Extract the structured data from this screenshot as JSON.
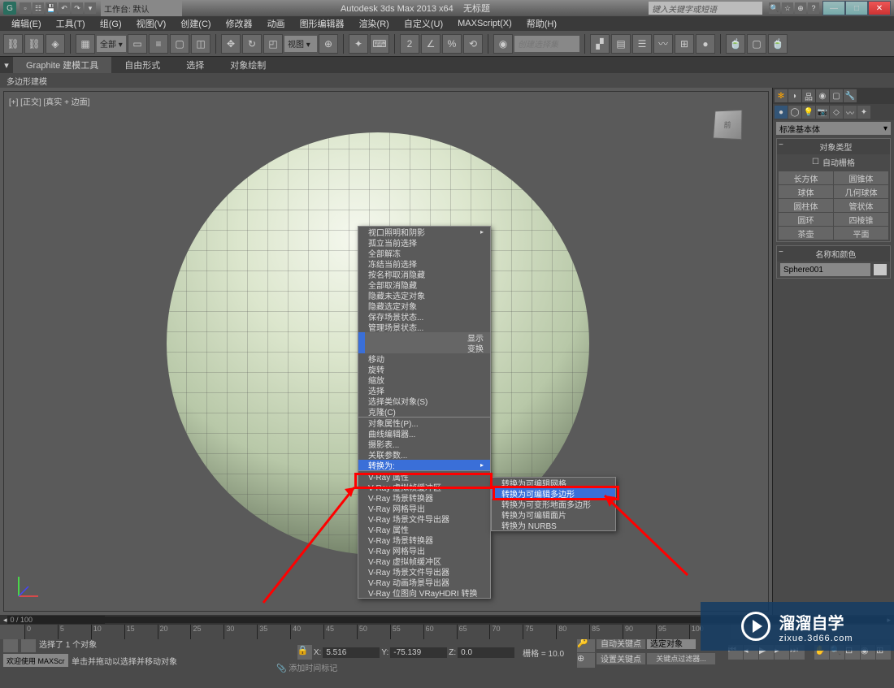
{
  "title_bar": {
    "app_title": "Autodesk 3ds Max  2013 x64",
    "doc_title": "无标题",
    "workspace_label": "工作台: 默认",
    "search_placeholder": "键入关键字或短语"
  },
  "menu_bar": {
    "items": [
      "编辑(E)",
      "工具(T)",
      "组(G)",
      "视图(V)",
      "创建(C)",
      "修改器",
      "动画",
      "图形编辑器",
      "渲染(R)",
      "自定义(U)",
      "MAXScript(X)",
      "帮助(H)"
    ]
  },
  "toolbar": {
    "selection_set": "创建选择集"
  },
  "ribbon": {
    "tabs": [
      "Graphite 建模工具",
      "自由形式",
      "选择",
      "对象绘制"
    ],
    "subtab": "多边形建模"
  },
  "viewport": {
    "label": "[+] [正交] [真实 + 边面]",
    "cube_face": "前"
  },
  "context_menu": {
    "items": [
      "视口照明和阴影",
      "孤立当前选择",
      "全部解冻",
      "冻结当前选择",
      "按名称取消隐藏",
      "全部取消隐藏",
      "隐藏未选定对象",
      "隐藏选定对象",
      "保存场景状态...",
      "管理场景状态..."
    ],
    "headers": [
      "显示",
      "变换"
    ],
    "items2": [
      "移动",
      "旋转",
      "缩放",
      "选择",
      "选择类似对象(S)",
      "克隆(C)",
      "对象属性(P)...",
      "曲线编辑器...",
      "摄影表...",
      "关联参数..."
    ],
    "convert_label": "转换为:",
    "items3": [
      "V-Ray 属性",
      "V-Ray 虚拟帧缓冲区",
      "V-Ray 场景转换器",
      "V-Ray 网格导出",
      "V-Ray 场景文件导出器",
      "V-Ray 属性",
      "V-Ray 场景转换器",
      "V-Ray 网格导出",
      "V-Ray 虚拟帧缓冲区",
      "V-Ray 场景文件导出器",
      "V-Ray 动画场景导出器",
      "V-Ray 位图向 VRayHDRI 转换"
    ]
  },
  "submenu": {
    "items": [
      "转换为可编辑网格",
      "转换为可编辑多边形",
      "转换为可变形地面多边形",
      "转换为可编辑面片",
      "转换为 NURBS"
    ]
  },
  "right_panel": {
    "primitive_dropdown": "标准基本体",
    "section1_title": "对象类型",
    "autogrid": "自动栅格",
    "primitives": [
      "长方体",
      "圆锥体",
      "球体",
      "几何球体",
      "圆柱体",
      "管状体",
      "圆环",
      "四棱锥",
      "茶壶",
      "平面"
    ],
    "section2_title": "名称和颜色",
    "object_name": "Sphere001"
  },
  "timeline": {
    "frame_display": "0 / 100",
    "ticks": [
      "0",
      "5",
      "10",
      "15",
      "20",
      "25",
      "30",
      "35",
      "40",
      "45",
      "50",
      "55",
      "60",
      "65",
      "70",
      "75",
      "80",
      "85",
      "90",
      "95",
      "100"
    ]
  },
  "status": {
    "welcome": "欢迎使用  MAXScr",
    "selected": "选择了 1 个对象",
    "hint": "单击并拖动以选择并移动对象",
    "x_label": "X:",
    "x_val": "5.516",
    "y_label": "Y:",
    "y_val": "-75.139",
    "z_label": "Z:",
    "z_val": "0.0",
    "grid": "栅格 = 10.0",
    "add_time": "添加时间标记",
    "autokey": "自动关键点",
    "setkey": "设置关键点",
    "selset": "选定对象",
    "keyfilter": "关键点过滤器..."
  },
  "watermark": {
    "title": "溜溜自学",
    "url": "zixue.3d66.com"
  }
}
